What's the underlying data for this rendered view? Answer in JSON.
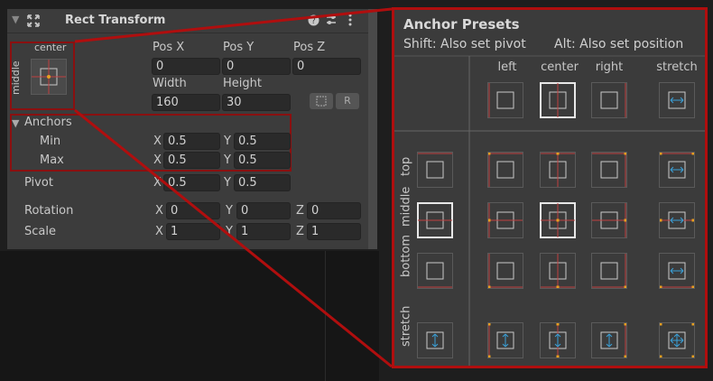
{
  "inspector": {
    "title": "Rect Transform",
    "anchor_widget": {
      "horizontal_label": "center",
      "vertical_label": "middle"
    },
    "pos_x_label": "Pos X",
    "pos_y_label": "Pos Y",
    "pos_z_label": "Pos Z",
    "pos_x": "0",
    "pos_y": "0",
    "pos_z": "0",
    "width_label": "Width",
    "height_label": "Height",
    "width": "160",
    "height": "30",
    "raw_edit_label": "R",
    "anchors_label": "Anchors",
    "min_label": "Min",
    "max_label": "Max",
    "min_x": "0.5",
    "min_y": "0.5",
    "max_x": "0.5",
    "max_y": "0.5",
    "pivot_label": "Pivot",
    "pivot_x": "0.5",
    "pivot_y": "0.5",
    "rotation_label": "Rotation",
    "rot_x": "0",
    "rot_y": "0",
    "rot_z": "0",
    "scale_label": "Scale",
    "scale_x": "1",
    "scale_y": "1",
    "scale_z": "1",
    "axis_x": "X",
    "axis_y": "Y",
    "axis_z": "Z"
  },
  "presets": {
    "title": "Anchor Presets",
    "shift_hint": "Shift: Also set pivot",
    "alt_hint": "Alt: Also set position",
    "columns": [
      "left",
      "center",
      "right",
      "stretch"
    ],
    "rows": [
      "top",
      "middle",
      "bottom",
      "stretch"
    ],
    "selected": "middle-center"
  },
  "colors": {
    "accent_red": "#b00e0e",
    "anchor_red": "#c04040",
    "handle_orange": "#e8a020",
    "stretch_blue": "#3aa0d8"
  }
}
